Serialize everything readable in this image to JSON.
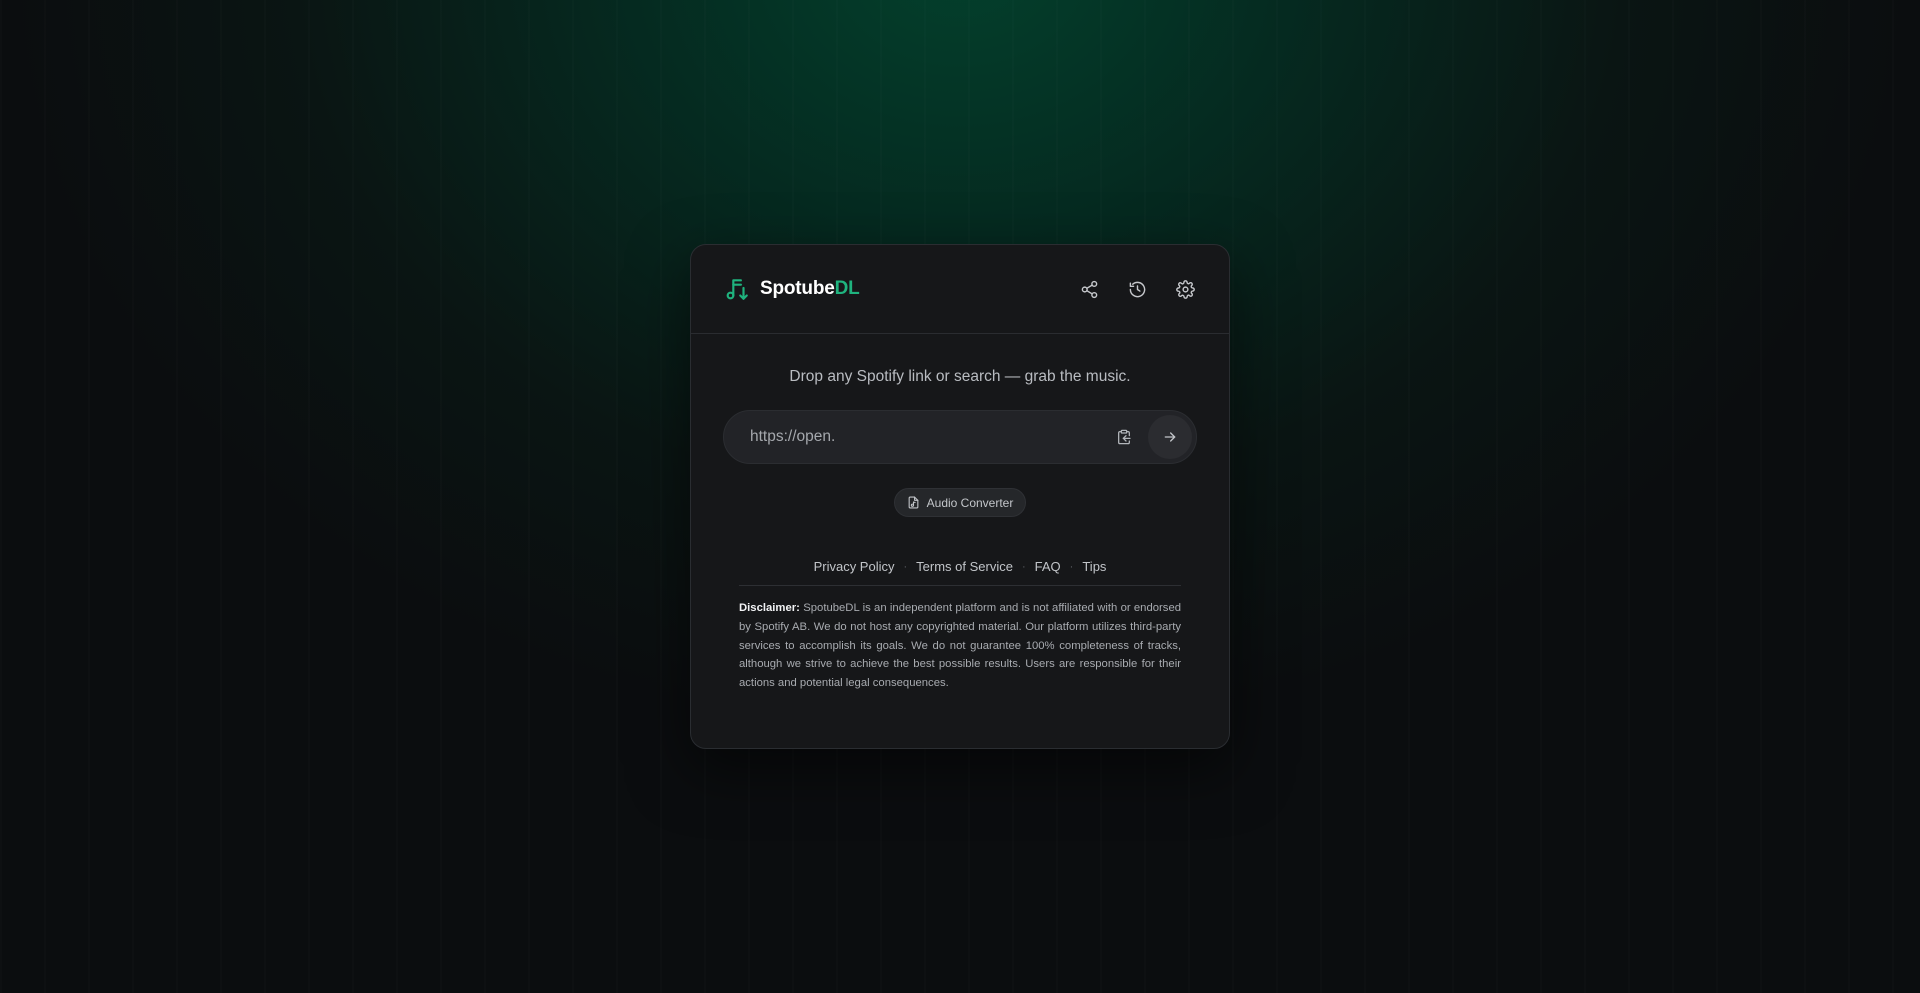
{
  "brand": {
    "name_main": "Spotube",
    "name_accent": "DL",
    "accent_color": "#1fb37e"
  },
  "header": {
    "actions": [
      {
        "icon": "share-icon"
      },
      {
        "icon": "history-icon"
      },
      {
        "icon": "gear-icon"
      }
    ]
  },
  "main": {
    "tagline": "Drop any Spotify link or search — grab the music.",
    "search": {
      "value": "",
      "placeholder": "https://open."
    },
    "converter_label": "Audio Converter"
  },
  "footer": {
    "links": [
      {
        "label": "Privacy Policy"
      },
      {
        "label": "Terms of Service"
      },
      {
        "label": "FAQ"
      },
      {
        "label": "Tips"
      }
    ],
    "disclaimer_label": "Disclaimer:",
    "disclaimer_text": "SpotubeDL is an independent platform and is not affiliated with or endorsed by Spotify AB. We do not host any copyrighted material. Our platform utilizes third-party services to accomplish its goals. We do not guarantee 100% completeness of tracks, although we strive to achieve the best possible results. Users are responsible for their actions and potential legal consequences."
  }
}
